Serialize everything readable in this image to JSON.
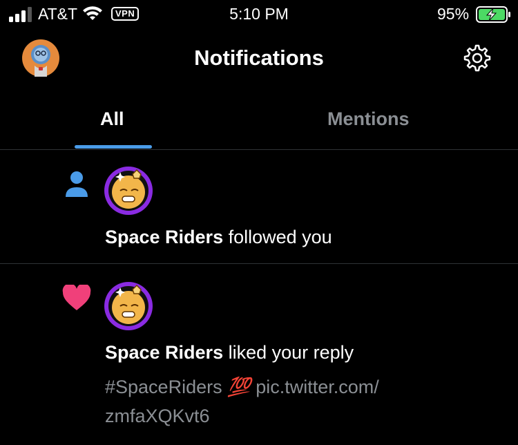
{
  "status_bar": {
    "carrier": "AT&T",
    "vpn": "VPN",
    "time": "5:10 PM",
    "battery": "95%"
  },
  "header": {
    "title": "Notifications"
  },
  "tabs": [
    {
      "label": "All",
      "selected": true
    },
    {
      "label": "Mentions",
      "selected": false
    }
  ],
  "notifications": [
    {
      "icon": "person-icon",
      "user": "Space Riders",
      "action": " followed you"
    },
    {
      "icon": "heart-icon",
      "user": "Space Riders",
      "action": " liked your reply",
      "tweet_hashtag": "#SpaceRiders",
      "tweet_emoji": "💯",
      "tweet_link_1": "pic.twitter.com/",
      "tweet_link_2": "zmfaXQKvt6"
    }
  ],
  "colors": {
    "accent": "#4a9be8",
    "like": "#f0407a",
    "muted": "#8b8f94"
  }
}
